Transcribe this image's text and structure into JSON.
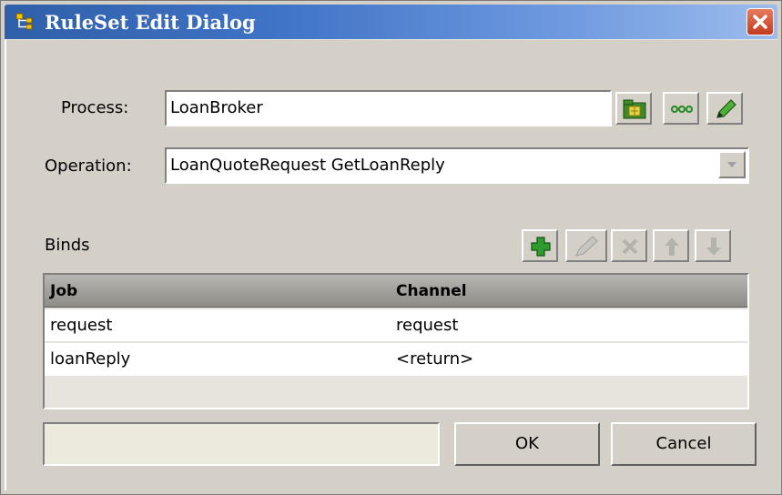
{
  "window": {
    "title": "RuleSet Edit Dialog",
    "title_icon": "ruleset-tree-icon",
    "close_icon": "close-icon"
  },
  "process": {
    "label": "Process:",
    "value": "LoanBroker",
    "buttons": [
      "browse-folder-icon",
      "ellipsis-icon",
      "edit-pencil-icon"
    ]
  },
  "operation": {
    "label": "Operation:",
    "value": "LoanQuoteRequest GetLoanReply",
    "arrow_icon": "chevron-down-icon"
  },
  "binds": {
    "label": "Binds",
    "toolbar": [
      "add-icon",
      "edit-icon",
      "delete-icon",
      "move-up-icon",
      "move-down-icon"
    ],
    "columns": [
      "Job",
      "Channel"
    ],
    "rows": [
      {
        "job": "request",
        "channel": "request"
      },
      {
        "job": "loanReply",
        "channel": "<return>"
      }
    ]
  },
  "footer": {
    "status_text": "",
    "ok_label": "OK",
    "cancel_label": "Cancel"
  },
  "colors": {
    "dialog_bg": "#d4d0c8",
    "title_bar": "#3f73c6",
    "add_green": "#2e9b2e"
  }
}
